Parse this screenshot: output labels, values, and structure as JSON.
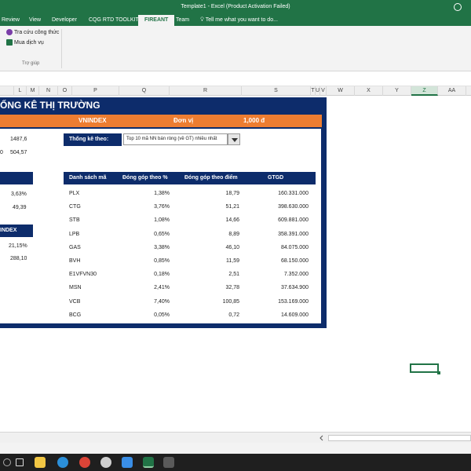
{
  "window": {
    "title": "Template1 - Excel (Product Activation Failed)"
  },
  "tabs": [
    {
      "label": "Review"
    },
    {
      "label": "View"
    },
    {
      "label": "Developer"
    },
    {
      "label": "CQG RTD TOOLKIT"
    },
    {
      "label": "FIREANT"
    },
    {
      "label": "Team"
    }
  ],
  "tell_me": "Tell me what you want to do...",
  "ribbon": {
    "btn1": "Tra cứu công thức",
    "btn2": "Mua dịch vụ",
    "group": "Trợ giúp"
  },
  "columns": [
    "L",
    "M",
    "N",
    "O",
    "P",
    "Q",
    "R",
    "S",
    "T",
    "U",
    "V",
    "W",
    "X",
    "Y",
    "Z",
    "AA"
  ],
  "sheet": {
    "title": "ỐNG KÊ THỊ TRƯỜNG",
    "header_index": "VNINDEX",
    "header_unit_label": "Đơn vị",
    "header_unit_value": "1,000 đ",
    "left_values": {
      "v1": "1487,6",
      "v2_prefix": "0",
      "v2": "504,57",
      "v3": "3,63%",
      "v4": "49,39",
      "box_label": "INDEX",
      "v5": "21,15%",
      "v6": "288,10"
    },
    "combo_label": "Thống kê theo:",
    "combo_value": "Top 10 mã NN bán ròng (về GT) nhiều nhất",
    "table": {
      "headers": [
        "Danh sách mã",
        "Đóng góp theo %",
        "Đóng góp theo điểm",
        "GTGD"
      ],
      "rows": [
        {
          "code": "PLX",
          "pct": "1,38%",
          "pts": "18,79",
          "val": "160.331.000"
        },
        {
          "code": "CTG",
          "pct": "3,76%",
          "pts": "51,21",
          "val": "398.630.000"
        },
        {
          "code": "STB",
          "pct": "1,08%",
          "pts": "14,66",
          "val": "609.881.000"
        },
        {
          "code": "LPB",
          "pct": "0,65%",
          "pts": "8,89",
          "val": "358.391.000"
        },
        {
          "code": "GAS",
          "pct": "3,38%",
          "pts": "46,10",
          "val": "84.075.000"
        },
        {
          "code": "BVH",
          "pct": "0,85%",
          "pts": "11,59",
          "val": "68.150.000"
        },
        {
          "code": "E1VFVN30",
          "pct": "0,18%",
          "pts": "2,51",
          "val": "7.352.000"
        },
        {
          "code": "MSN",
          "pct": "2,41%",
          "pts": "32,78",
          "val": "37.634.900"
        },
        {
          "code": "VCB",
          "pct": "7,40%",
          "pts": "100,85",
          "val": "153.169.000"
        },
        {
          "code": "BCG",
          "pct": "0,05%",
          "pts": "0,72",
          "val": "14.609.000"
        }
      ]
    }
  },
  "colors": {
    "excel_green": "#217346",
    "navy": "#0d2c6b",
    "orange": "#ed7d31"
  }
}
